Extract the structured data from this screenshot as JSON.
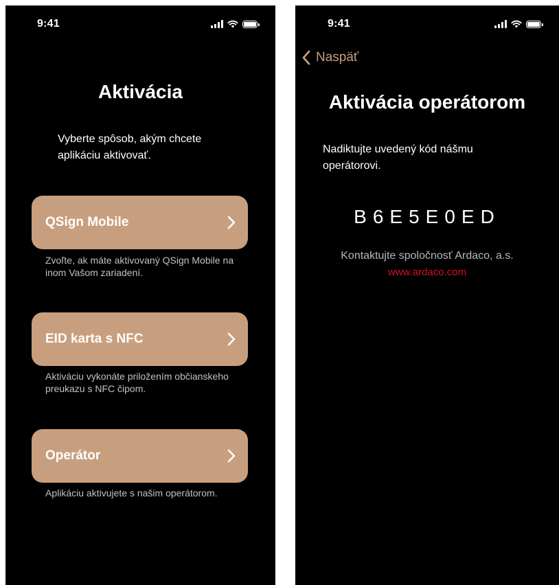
{
  "colors": {
    "accent": "#c89f7e",
    "background": "#000000",
    "link": "#d2112a",
    "secondary_text": "#c2c2c2"
  },
  "left_screen": {
    "status_time": "9:41",
    "title": "Aktivácia",
    "intro": "Vyberte spôsob, akým chcete aplikáciu aktivovať.",
    "options": [
      {
        "label": "QSign Mobile",
        "icon": "chevron-right-icon",
        "description": "Zvoľte, ak máte aktivovaný QSign Mobile na inom Vašom zariadení."
      },
      {
        "label": "EID karta s NFC",
        "icon": "chevron-right-icon",
        "description": "Aktiváciu vykonáte priložením občianskeho preukazu s NFC čipom."
      },
      {
        "label": "Operátor",
        "icon": "chevron-right-icon",
        "description": "Aplikáciu aktivujete s našim operátorom."
      }
    ]
  },
  "right_screen": {
    "status_time": "9:41",
    "back_label": "Naspäť",
    "title": "Aktivácia operátorom",
    "instruction": "Nadiktujte uvedený kód nášmu operátorovi.",
    "code": "B6E5E0ED",
    "contact_text": "Kontaktujte spoločnosť Ardaco, a.s.",
    "link_text": "www.ardaco.com"
  }
}
